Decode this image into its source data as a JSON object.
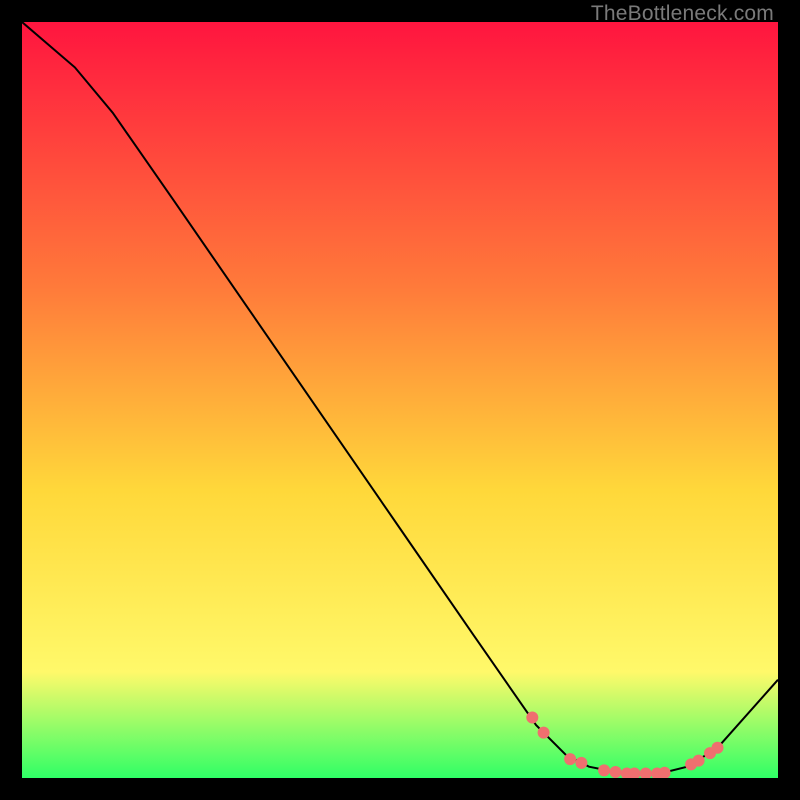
{
  "watermark": "TheBottleneck.com",
  "colors": {
    "bg_black": "#000000",
    "grad_top": "#ff153f",
    "grad_mid1": "#ff7a3a",
    "grad_mid2": "#ffd83a",
    "grad_mid3": "#fff96a",
    "grad_bottom": "#2fff66",
    "line": "#000000",
    "marker": "#ef6f6f"
  },
  "chart_data": {
    "type": "line",
    "title": "",
    "xlabel": "",
    "ylabel": "",
    "xlim": [
      0,
      100
    ],
    "ylim": [
      0,
      100
    ],
    "series": [
      {
        "name": "bottleneck-curve",
        "x": [
          0,
          7,
          12,
          20,
          30,
          40,
          50,
          60,
          68,
          72,
          75,
          80,
          84,
          88,
          92,
          100
        ],
        "y": [
          100,
          94,
          88,
          76.5,
          62,
          47.5,
          33,
          18.5,
          7,
          3,
          1.5,
          0.5,
          0.5,
          1.5,
          4,
          13
        ]
      }
    ],
    "markers": {
      "name": "highlighted-points",
      "x": [
        67.5,
        69,
        72.5,
        74,
        77,
        78.5,
        80,
        81,
        82.5,
        84,
        85,
        88.5,
        89.5,
        91,
        92
      ],
      "y": [
        8,
        6,
        2.5,
        2,
        1,
        0.8,
        0.6,
        0.6,
        0.6,
        0.6,
        0.7,
        1.8,
        2.3,
        3.3,
        4
      ]
    }
  }
}
